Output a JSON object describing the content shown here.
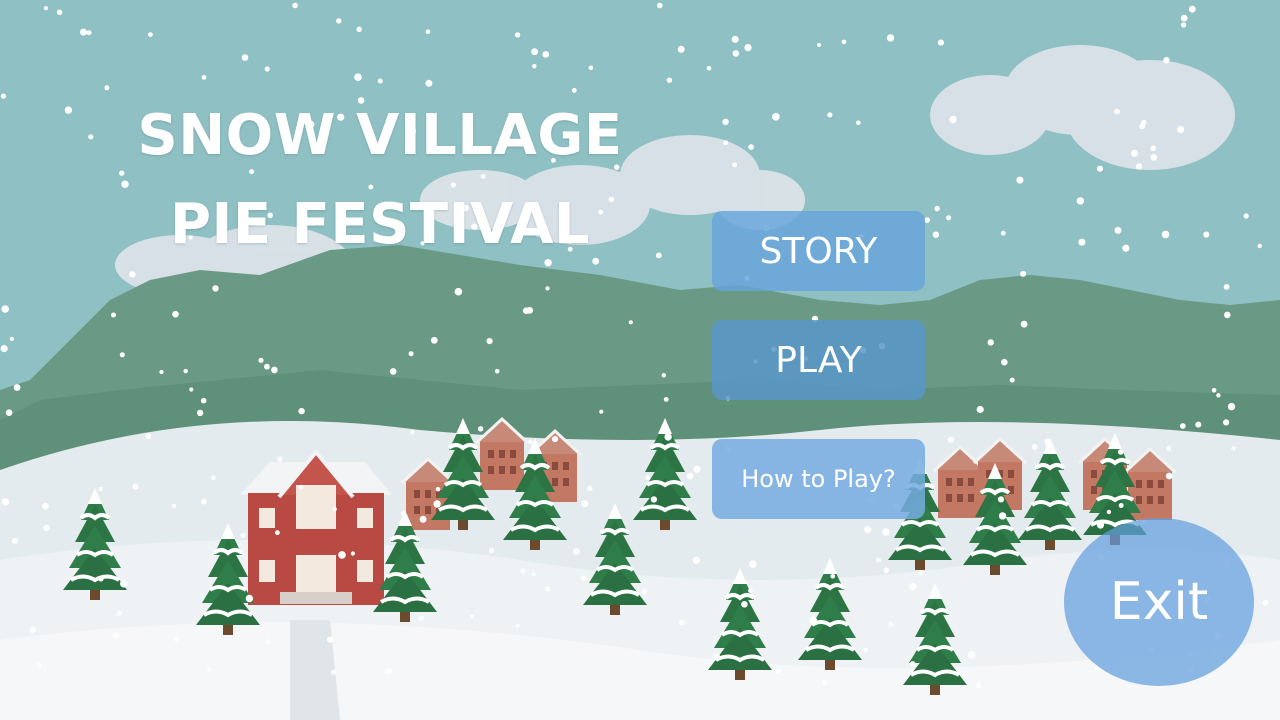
{
  "game": {
    "title_line1": "SNOW VILLAGE",
    "title_line2": "PIE FESTIVAL"
  },
  "menu": {
    "story_label": "STORY",
    "play_label": "PLAY",
    "howto_label": "How to Play?",
    "exit_label": "Exit"
  },
  "colors": {
    "sky": "#8fc0c3",
    "forest": "#6a9a86",
    "snow": "#eef2f4",
    "house_red": "#b94a43",
    "tree_green": "#2f7d49",
    "button_blue": "#6aa3dc"
  }
}
